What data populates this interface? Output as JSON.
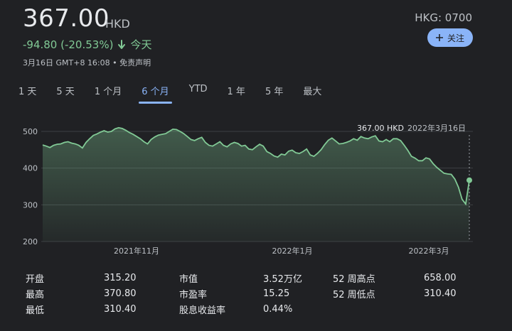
{
  "header": {
    "price": "367.00",
    "currency": "HKD",
    "change": "-94.80 (-20.53%)",
    "period": "今天",
    "meta": "3月16日 GMT+8 16:08 • 免责声明",
    "ticker": "HKG: 0700",
    "follow_label": "关注"
  },
  "tabs": [
    {
      "label": "1 天"
    },
    {
      "label": "5 天"
    },
    {
      "label": "1 个月"
    },
    {
      "label": "6 个月",
      "active": true
    },
    {
      "label": "YTD"
    },
    {
      "label": "1 年"
    },
    {
      "label": "5 年"
    },
    {
      "label": "最大"
    }
  ],
  "tooltip": {
    "value": "367.00 HKD",
    "date": "2022年3月16日"
  },
  "chart_data": {
    "type": "area",
    "ylim": [
      200,
      520
    ],
    "yticks": [
      500,
      400,
      300,
      200
    ],
    "xticks": [
      "2021年11月",
      "2022年1月",
      "2022年3月"
    ],
    "grid": true,
    "line_color": "#81c995",
    "series": [
      {
        "values": [
          463,
          460,
          456,
          462,
          465,
          466,
          470,
          472,
          468,
          466,
          462,
          455,
          470,
          480,
          489,
          493,
          498,
          502,
          498,
          500,
          507,
          510,
          508,
          503,
          497,
          492,
          486,
          480,
          472,
          466,
          478,
          485,
          490,
          492,
          494,
          500,
          506,
          505,
          500,
          494,
          486,
          478,
          475,
          480,
          484,
          470,
          462,
          460,
          466,
          472,
          462,
          458,
          466,
          470,
          467,
          460,
          462,
          452,
          450,
          458,
          465,
          460,
          445,
          440,
          433,
          430,
          438,
          436,
          446,
          449,
          442,
          440,
          445,
          452,
          436,
          432,
          440,
          450,
          464,
          476,
          482,
          474,
          466,
          467,
          470,
          474,
          480,
          476,
          486,
          482,
          480,
          485,
          488,
          474,
          472,
          478,
          472,
          480,
          480,
          475,
          462,
          448,
          432,
          427,
          420,
          420,
          428,
          425,
          412,
          402,
          394,
          386,
          384,
          383,
          370,
          348,
          315,
          302,
          367
        ]
      }
    ]
  },
  "stats": [
    {
      "label": "开盘",
      "value": "315.20"
    },
    {
      "label": "市值",
      "value": "3.52万亿"
    },
    {
      "label": "52 周高点",
      "value": "658.00"
    },
    {
      "label": "最高",
      "value": "370.80"
    },
    {
      "label": "市盈率",
      "value": "15.25"
    },
    {
      "label": "52 周低点",
      "value": "310.40"
    },
    {
      "label": "最低",
      "value": "310.40"
    },
    {
      "label": "股息收益率",
      "value": "0.44%"
    }
  ]
}
